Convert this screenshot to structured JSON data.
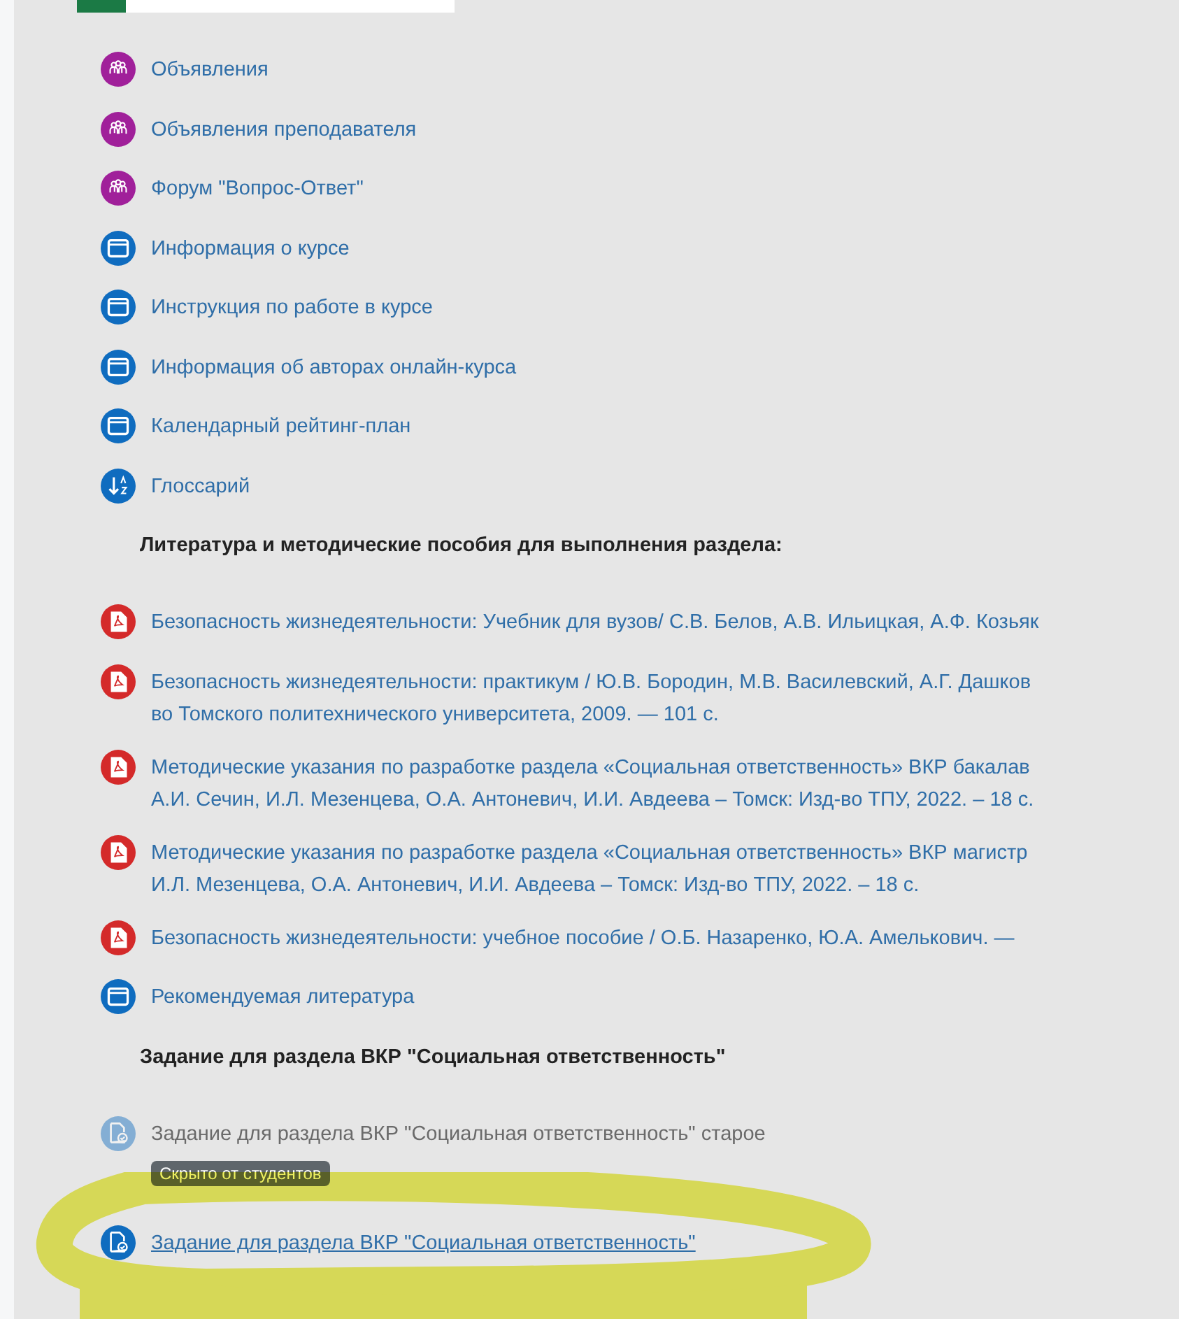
{
  "items": [
    {
      "kind": "forum",
      "lines": [
        "Объявления"
      ],
      "dimmed": false,
      "highlighted": false
    },
    {
      "kind": "forum",
      "lines": [
        "Объявления преподавателя"
      ],
      "dimmed": false,
      "highlighted": false
    },
    {
      "kind": "forum",
      "lines": [
        "Форум \"Вопрос-Ответ\""
      ],
      "dimmed": false,
      "highlighted": false
    },
    {
      "kind": "page",
      "lines": [
        "Информация о курсе"
      ],
      "dimmed": false,
      "highlighted": false
    },
    {
      "kind": "page",
      "lines": [
        "Инструкция по работе в курсе"
      ],
      "dimmed": false,
      "highlighted": false
    },
    {
      "kind": "page",
      "lines": [
        "Информация об авторах онлайн-курса"
      ],
      "dimmed": false,
      "highlighted": false
    },
    {
      "kind": "page",
      "lines": [
        "Календарный рейтинг-план"
      ],
      "dimmed": false,
      "highlighted": false
    },
    {
      "kind": "glossary",
      "lines": [
        "Глоссарий"
      ],
      "dimmed": false,
      "highlighted": false
    },
    {
      "kind": "heading",
      "lines": [
        "Литература и методические пособия для выполнения раздела:"
      ]
    },
    {
      "kind": "pdf",
      "lines": [
        "Безопасность жизнедеятельности: Учебник для вузов/ С.В. Белов, А.В. Ильицкая, А.Ф. Козьяк"
      ],
      "dimmed": false,
      "highlighted": false
    },
    {
      "kind": "pdf",
      "lines": [
        "Безопасность жизнедеятельности: практикум / Ю.В. Бородин, М.В. Василевский, А.Г. Дашков",
        "во Томского политехнического университета, 2009. — 101 с."
      ],
      "dimmed": false,
      "highlighted": false
    },
    {
      "kind": "pdf",
      "lines": [
        "Методические указания по разработке раздела «Социальная ответственность» ВКР бакалав",
        "А.И. Сечин, И.Л. Мезенцева, О.А. Антоневич, И.И. Авдеева – Томск: Изд-во ТПУ, 2022. – 18 с."
      ],
      "dimmed": false,
      "highlighted": false
    },
    {
      "kind": "pdf",
      "lines": [
        "Методические указания по разработке раздела «Социальная ответственность» ВКР магистр",
        "И.Л. Мезенцева, О.А. Антоневич, И.И. Авдеева – Томск: Изд-во ТПУ, 2022. – 18 с."
      ],
      "dimmed": false,
      "highlighted": false
    },
    {
      "kind": "pdf",
      "lines": [
        "Безопасность жизнедеятельности: учебное пособие / О.Б. Назаренко, Ю.А. Амелькович. —"
      ],
      "dimmed": false,
      "highlighted": false
    },
    {
      "kind": "page",
      "lines": [
        "Рекомендуемая литература"
      ],
      "dimmed": false,
      "highlighted": false
    },
    {
      "kind": "heading",
      "lines": [
        "Задание для раздела ВКР \"Социальная ответственность\""
      ]
    },
    {
      "kind": "assign",
      "lines": [
        "Задание для раздела ВКР \"Социальная ответственность\" старое"
      ],
      "dimmed": true,
      "badge": "Скрыто от студентов",
      "highlighted": false
    },
    {
      "kind": "assign",
      "lines": [
        "Задание для раздела ВКР \"Социальная ответственность\""
      ],
      "dimmed": false,
      "highlighted": true
    }
  ]
}
